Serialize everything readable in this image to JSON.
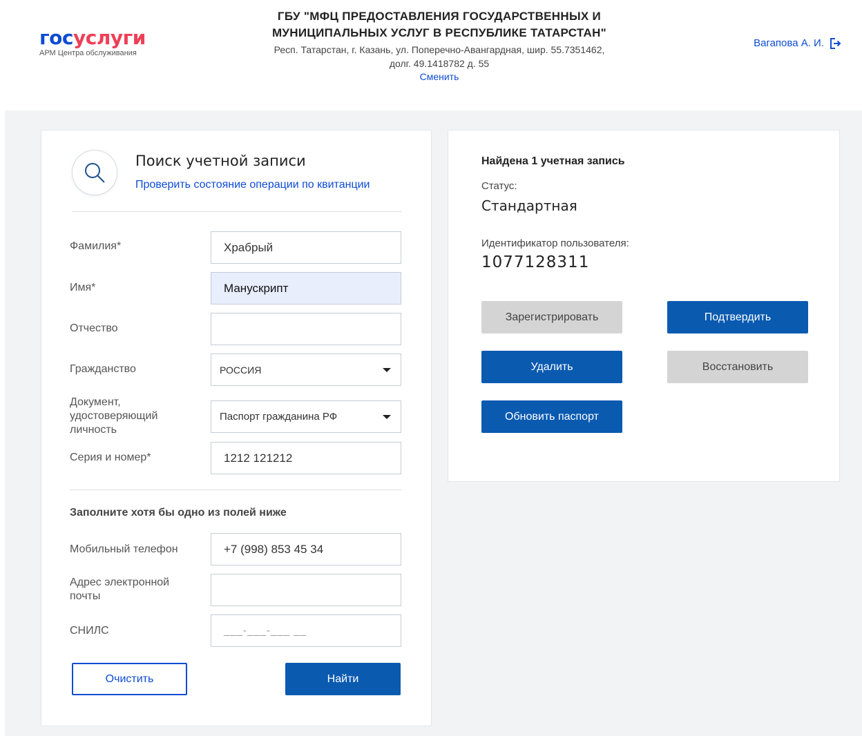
{
  "header": {
    "logo_gos": "гос",
    "logo_uslugi": "услуги",
    "logo_subtitle": "АРМ Центра обслуживания",
    "org_title_line1": "ГБУ \"МФЦ ПРЕДОСТАВЛЕНИЯ ГОСУДАРСТВЕННЫХ И",
    "org_title_line2": "МУНИЦИПАЛЬНЫХ УСЛУГ В РЕСПУБЛИКЕ ТАТАРСТАН\"",
    "org_address_line1": "Респ. Татарстан, г. Казань, ул. Поперечно-Авангардная, шир. 55.7351462,",
    "org_address_line2": "долг. 49.1418782 д. 55",
    "change_link": "Сменить",
    "user_name": "Вагапова А. И.",
    "logout_icon": "logout-icon"
  },
  "search": {
    "title": "Поиск учетной записи",
    "receipt_link": "Проверить состояние операции по квитанции",
    "icon": "search-icon",
    "fields": {
      "last_name": {
        "label": "Фамилия*",
        "value": "Храбрый"
      },
      "first_name": {
        "label": "Имя*",
        "value": "Манускрипт"
      },
      "middle_name": {
        "label": "Отчество",
        "value": ""
      },
      "citizenship": {
        "label": "Гражданство",
        "value": "РОССИЯ"
      },
      "document": {
        "label_line1": "Документ,",
        "label_line2": "удостоверяющий",
        "label_line3": "личность",
        "value": "Паспорт гражданина РФ"
      },
      "series_number": {
        "label": "Серия и номер*",
        "value": "1212 121212"
      }
    },
    "hint": "Заполните хотя бы одно из полей ниже",
    "contact_fields": {
      "phone": {
        "label": "Мобильный телефон",
        "value": "+7 (998) 853 45 34"
      },
      "email": {
        "label_line1": "Адрес электронной",
        "label_line2": "почты",
        "value": ""
      },
      "snils": {
        "label": "СНИЛС",
        "placeholder": "___-___-___ __"
      }
    },
    "clear_button": "Очистить",
    "find_button": "Найти"
  },
  "result": {
    "title": "Найдена 1 учетная запись",
    "status_label": "Статус:",
    "status_value": "Стандартная",
    "user_id_label": "Идентификатор пользователя:",
    "user_id_value": "1077128311",
    "buttons": {
      "register": "Зарегистрировать",
      "confirm": "Подтвердить",
      "delete": "Удалить",
      "restore": "Восстановить",
      "update_passport": "Обновить паспорт"
    }
  },
  "colors": {
    "brand_blue": "#0d4cd3",
    "brand_red": "#ee3f58",
    "primary_button": "#0a5ab0",
    "disabled_button": "#d4d4d4",
    "page_background": "#f2f3f4"
  }
}
